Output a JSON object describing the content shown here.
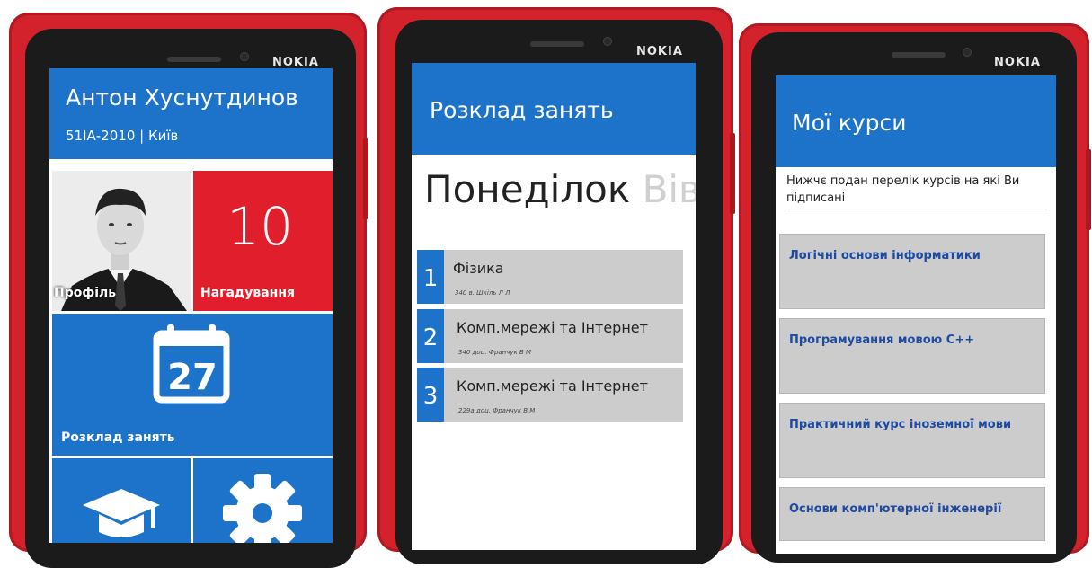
{
  "brand": "NOKIA",
  "colors": {
    "phone_red": "#d3222b",
    "tile_blue": "#1d72c9",
    "tile_red": "#e01e2c",
    "lesson_gray": "#cccccc",
    "course_text": "#1e4aa0"
  },
  "screen1": {
    "user_name": "Антон Хуснутдинов",
    "user_meta": "51ІА-2010 | Київ",
    "tiles": {
      "profile_label": "Профіль",
      "reminders_count": "10",
      "reminders_label": "Нагадування",
      "calendar_day": "27",
      "schedule_label": "Розклад занять"
    },
    "icons": [
      "calendar-icon",
      "graduation-cap-icon",
      "gear-icon"
    ]
  },
  "screen2": {
    "title": "Розклад занять",
    "day": "Понеділок",
    "next_day": "Вів",
    "lessons": [
      {
        "number": "1",
        "name": "Фізика",
        "info": "340 в. Шкіль Л Л"
      },
      {
        "number": "2",
        "name": "Комп.мережі та Інтернет",
        "info": "340 доц. Франчук В М"
      },
      {
        "number": "3",
        "name": "Комп.мережі та Інтернет",
        "info": "229а доц. Франчук В М"
      }
    ]
  },
  "screen3": {
    "title": "Мої курси",
    "description": "Нижчє подан перелік курсів на які Ви підписані",
    "courses": [
      "Логічні основи інформатики",
      "Програмування мовою С++",
      "Практичний курс іноземної мови",
      "Основи комп'ютерної інженерії"
    ]
  }
}
